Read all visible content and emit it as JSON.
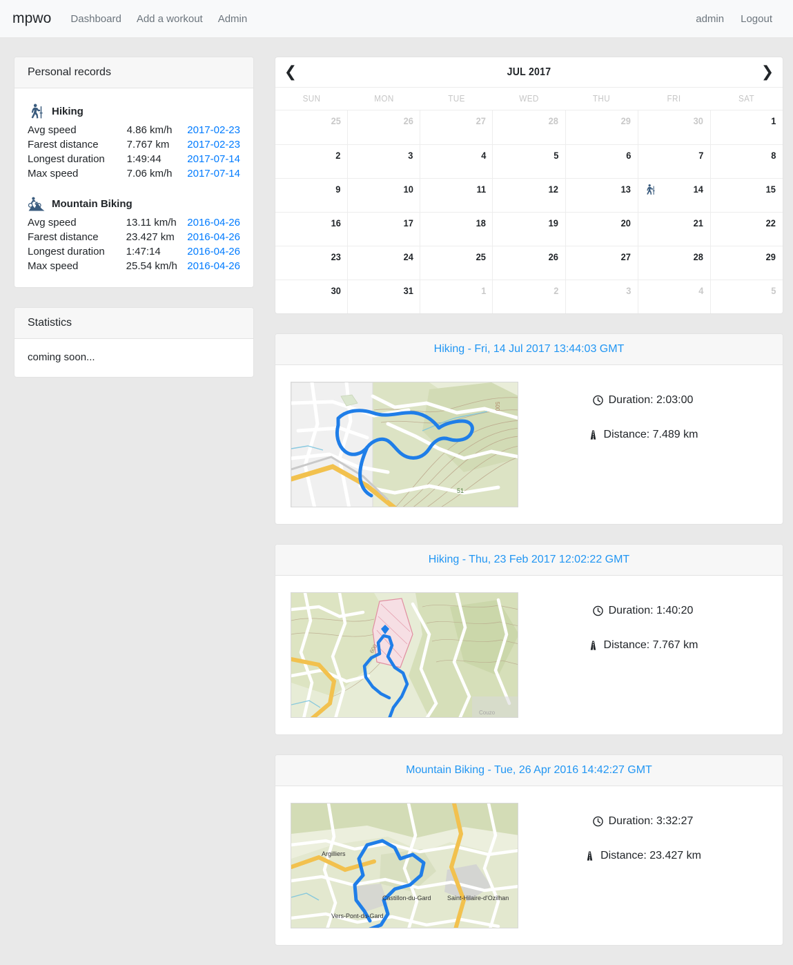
{
  "navbar": {
    "brand": "mpwo",
    "links": [
      {
        "label": "Dashboard",
        "name": "nav-link-dashboard"
      },
      {
        "label": "Add a workout",
        "name": "nav-link-add-workout"
      },
      {
        "label": "Admin",
        "name": "nav-link-admin"
      }
    ],
    "user": "admin",
    "logout": "Logout"
  },
  "personal_records": {
    "title": "Personal records",
    "sports": [
      {
        "name": "Hiking",
        "icon": "hiking-icon",
        "rows": [
          {
            "label": "Avg speed",
            "value": "4.86 km/h",
            "date": "2017-02-23"
          },
          {
            "label": "Farest distance",
            "value": "7.767 km",
            "date": "2017-02-23"
          },
          {
            "label": "Longest duration",
            "value": "1:49:44",
            "date": "2017-07-14"
          },
          {
            "label": "Max speed",
            "value": "7.06 km/h",
            "date": "2017-07-14"
          }
        ]
      },
      {
        "name": "Mountain Biking",
        "icon": "mountain-biking-icon",
        "rows": [
          {
            "label": "Avg speed",
            "value": "13.11 km/h",
            "date": "2016-04-26"
          },
          {
            "label": "Farest distance",
            "value": "23.427 km",
            "date": "2016-04-26"
          },
          {
            "label": "Longest duration",
            "value": "1:47:14",
            "date": "2016-04-26"
          },
          {
            "label": "Max speed",
            "value": "25.54 km/h",
            "date": "2016-04-26"
          }
        ]
      }
    ]
  },
  "statistics": {
    "title": "Statistics",
    "body": "coming soon..."
  },
  "calendar": {
    "title": "JUL 2017",
    "prev_label": "❮",
    "next_label": "❯",
    "day_headers": [
      "SUN",
      "MON",
      "TUE",
      "WED",
      "THU",
      "FRI",
      "SAT"
    ],
    "weeks": [
      [
        {
          "day": "25",
          "out": true
        },
        {
          "day": "26",
          "out": true
        },
        {
          "day": "27",
          "out": true
        },
        {
          "day": "28",
          "out": true
        },
        {
          "day": "29",
          "out": true
        },
        {
          "day": "30",
          "out": true
        },
        {
          "day": "1",
          "out": false
        }
      ],
      [
        {
          "day": "2",
          "out": false
        },
        {
          "day": "3",
          "out": false
        },
        {
          "day": "4",
          "out": false
        },
        {
          "day": "5",
          "out": false
        },
        {
          "day": "6",
          "out": false
        },
        {
          "day": "7",
          "out": false
        },
        {
          "day": "8",
          "out": false
        }
      ],
      [
        {
          "day": "9",
          "out": false
        },
        {
          "day": "10",
          "out": false
        },
        {
          "day": "11",
          "out": false
        },
        {
          "day": "12",
          "out": false
        },
        {
          "day": "13",
          "out": false
        },
        {
          "day": "14",
          "out": false,
          "workout": "hiking-icon"
        },
        {
          "day": "15",
          "out": false
        }
      ],
      [
        {
          "day": "16",
          "out": false
        },
        {
          "day": "17",
          "out": false
        },
        {
          "day": "18",
          "out": false
        },
        {
          "day": "19",
          "out": false
        },
        {
          "day": "20",
          "out": false
        },
        {
          "day": "21",
          "out": false
        },
        {
          "day": "22",
          "out": false
        }
      ],
      [
        {
          "day": "23",
          "out": false
        },
        {
          "day": "24",
          "out": false
        },
        {
          "day": "25",
          "out": false
        },
        {
          "day": "26",
          "out": false
        },
        {
          "day": "27",
          "out": false
        },
        {
          "day": "28",
          "out": false
        },
        {
          "day": "29",
          "out": false
        }
      ],
      [
        {
          "day": "30",
          "out": false
        },
        {
          "day": "31",
          "out": false
        },
        {
          "day": "1",
          "out": true
        },
        {
          "day": "2",
          "out": true
        },
        {
          "day": "3",
          "out": true
        },
        {
          "day": "4",
          "out": true
        },
        {
          "day": "5",
          "out": true
        }
      ]
    ]
  },
  "workouts": [
    {
      "title": "Hiking - Fri, 14 Jul 2017 13:44:03 GMT",
      "duration_label": "Duration: 2:03:00",
      "distance_label": "Distance: 7.489 km",
      "map": "map-thumbnail-1"
    },
    {
      "title": "Hiking - Thu, 23 Feb 2017 12:02:22 GMT",
      "duration_label": "Duration: 1:40:20",
      "distance_label": "Distance: 7.767 km",
      "map": "map-thumbnail-2"
    },
    {
      "title": "Mountain Biking - Tue, 26 Apr 2016 14:42:27 GMT",
      "duration_label": "Duration: 3:32:27",
      "distance_label": "Distance: 23.427 km",
      "map": "map-thumbnail-3"
    }
  ],
  "colors": {
    "link": "#007bff",
    "workout_title": "#2196f3",
    "track": "#1f7ee8",
    "page_bg": "#e9e9e9",
    "navbar_bg": "#f8f9fa",
    "card_header_bg": "#f7f7f7",
    "muted": "#c9c9c9"
  }
}
